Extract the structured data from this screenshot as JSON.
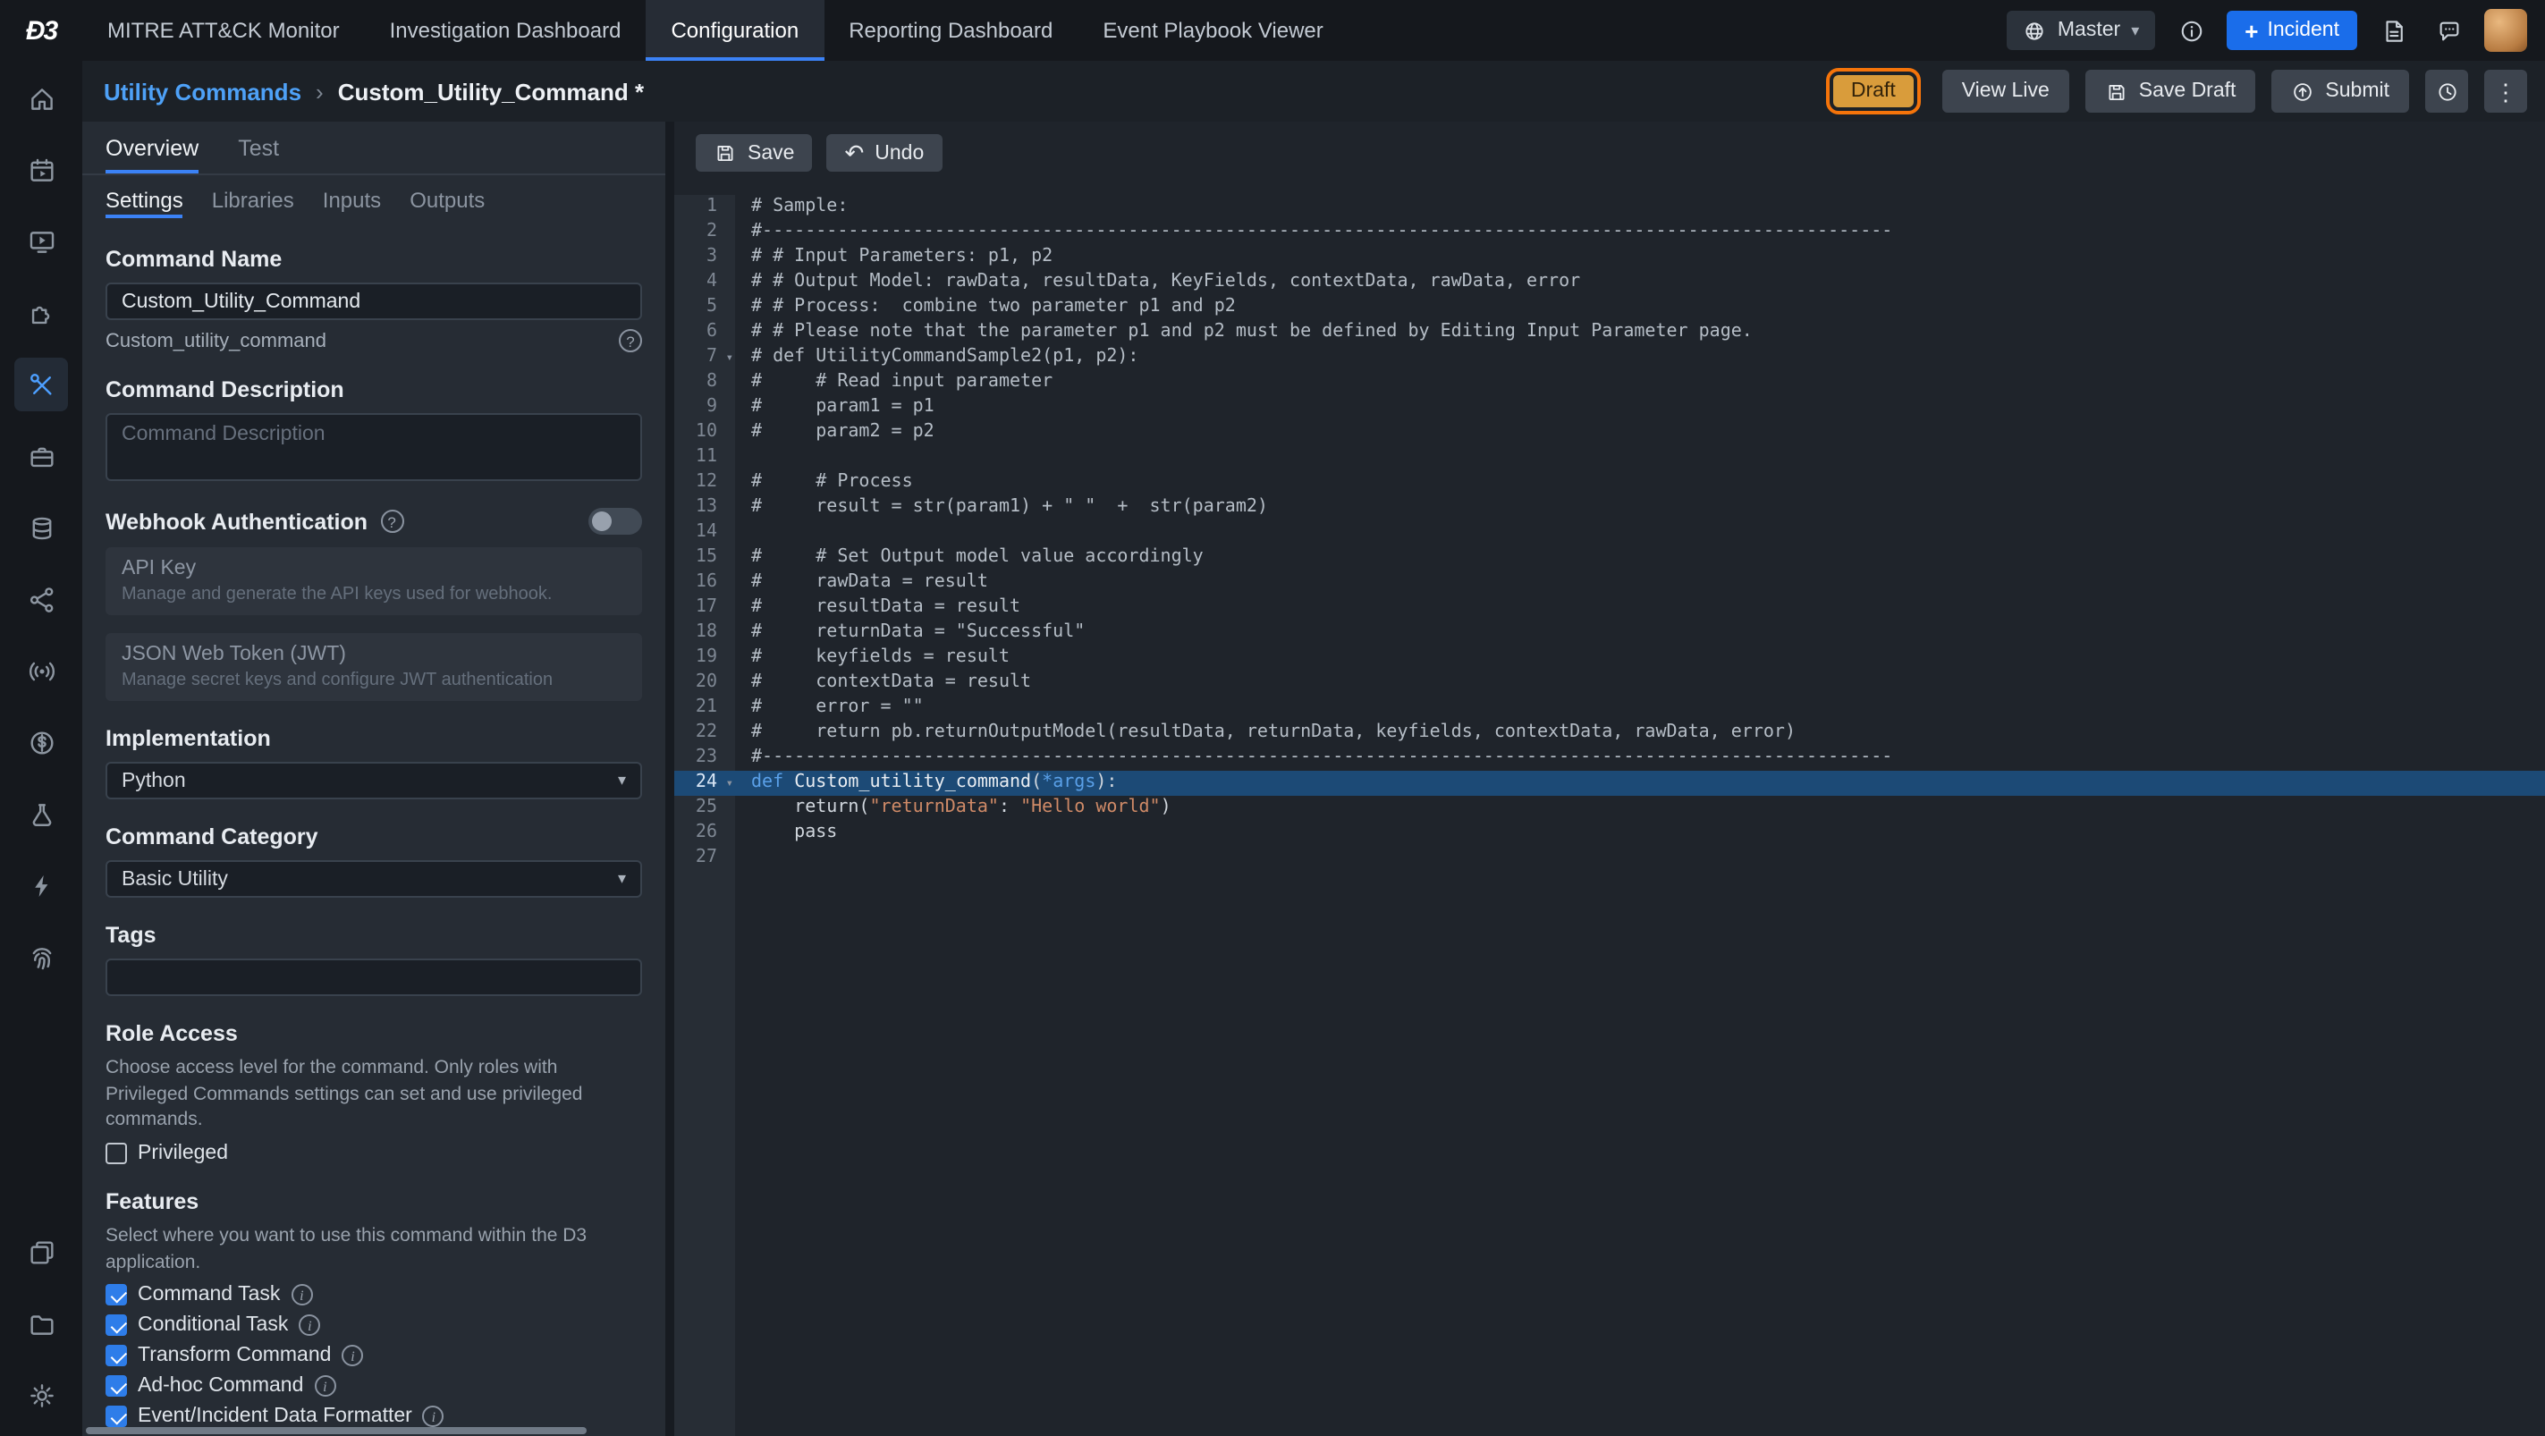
{
  "colors": {
    "accent_blue": "#3b82f6",
    "link_blue": "#4ea1f7",
    "incident_blue": "#1a6dea",
    "draft_badge_amber": "#d99c3b",
    "annotation_orange": "#f5740a",
    "active_line_blue": "#1c4a76",
    "editor_keyword": "#5aa0e8",
    "editor_string": "#cf8a67"
  },
  "topnav": {
    "logo": "Ð3",
    "items": [
      "MITRE ATT&CK Monitor",
      "Investigation Dashboard",
      "Configuration",
      "Reporting Dashboard",
      "Event Playbook Viewer"
    ],
    "active_index": 2,
    "master_label": "Master",
    "incident_label": "Incident"
  },
  "breadcrumb": {
    "parent": "Utility Commands",
    "separator": "›",
    "current": "Custom_Utility_Command *"
  },
  "header_actions": {
    "draft": "Draft",
    "view_live": "View Live",
    "save_draft": "Save Draft",
    "submit": "Submit"
  },
  "sidebar_rail": {
    "active_index": 4,
    "top": [
      "home-icon",
      "calendar-icon",
      "playbook-monitor-icon",
      "integrations-puzzle-icon",
      "utility-commands-tools-icon",
      "toolbox-icon",
      "data-stack-icon",
      "connections-share-icon",
      "live-signal-icon",
      "finance-globe-icon",
      "lab-flask-icon",
      "automation-bolt-icon",
      "fingerprint-icon"
    ],
    "bottom": [
      "window-copy-icon",
      "folders-icon",
      "settings-gear-icon"
    ]
  },
  "left_panel": {
    "tabs": [
      "Overview",
      "Test"
    ],
    "active_tab": 0,
    "subtabs": [
      "Settings",
      "Libraries",
      "Inputs",
      "Outputs"
    ],
    "active_subtab": 0,
    "command_name": {
      "label": "Command Name",
      "value": "Custom_Utility_Command",
      "internal_value": "Custom_utility_command"
    },
    "command_description": {
      "label": "Command Description",
      "placeholder": "Command Description",
      "value": ""
    },
    "webhook": {
      "label": "Webhook Authentication",
      "enabled": false,
      "api_key_title": "API Key",
      "api_key_desc": "Manage and generate the API keys used for webhook.",
      "jwt_title": "JSON Web Token (JWT)",
      "jwt_desc": "Manage secret keys and configure JWT authentication"
    },
    "implementation": {
      "label": "Implementation",
      "value": "Python"
    },
    "category": {
      "label": "Command Category",
      "value": "Basic Utility"
    },
    "tags": {
      "label": "Tags",
      "value": ""
    },
    "role_access": {
      "label": "Role Access",
      "desc": "Choose access level for the command. Only roles with Privileged Commands settings can set and use privileged commands.",
      "privileged_label": "Privileged",
      "privileged_checked": false
    },
    "features": {
      "label": "Features",
      "desc": "Select where you want to use this command within the D3 application.",
      "items": [
        {
          "label": "Command Task",
          "checked": true
        },
        {
          "label": "Conditional Task",
          "checked": true
        },
        {
          "label": "Transform Command",
          "checked": true
        },
        {
          "label": "Ad-hoc Command",
          "checked": true
        },
        {
          "label": "Event/Incident Data Formatter",
          "checked": true
        }
      ]
    }
  },
  "editor": {
    "toolbar": {
      "save": "Save",
      "undo": "Undo"
    },
    "active_line": 24,
    "lines": [
      {
        "n": 1,
        "segments": [
          {
            "t": "# Sample:",
            "c": "cm"
          }
        ]
      },
      {
        "n": 2,
        "segments": [
          {
            "t": "#---------------------------------------------------------------------------------------------------------",
            "c": "cm"
          }
        ]
      },
      {
        "n": 3,
        "segments": [
          {
            "t": "# # Input Parameters: p1, p2",
            "c": "cm"
          }
        ]
      },
      {
        "n": 4,
        "segments": [
          {
            "t": "# # Output Model: rawData, resultData, KeyFields, contextData, rawData, error",
            "c": "cm"
          }
        ]
      },
      {
        "n": 5,
        "segments": [
          {
            "t": "# # Process:  combine two parameter p1 and p2",
            "c": "cm"
          }
        ]
      },
      {
        "n": 6,
        "segments": [
          {
            "t": "# # Please note that the parameter p1 and p2 must be defined by Editing Input Parameter page.",
            "c": "cm"
          }
        ]
      },
      {
        "n": 7,
        "fold": true,
        "segments": [
          {
            "t": "# def UtilityCommandSample2(p1, p2):",
            "c": "cm"
          }
        ]
      },
      {
        "n": 8,
        "segments": [
          {
            "t": "#     # Read input parameter",
            "c": "cm"
          }
        ]
      },
      {
        "n": 9,
        "segments": [
          {
            "t": "#     param1 = p1",
            "c": "cm"
          }
        ]
      },
      {
        "n": 10,
        "segments": [
          {
            "t": "#     param2 = p2",
            "c": "cm"
          }
        ]
      },
      {
        "n": 11,
        "segments": []
      },
      {
        "n": 12,
        "segments": [
          {
            "t": "#     # Process",
            "c": "cm"
          }
        ]
      },
      {
        "n": 13,
        "segments": [
          {
            "t": "#     result = str(param1) + \" \"  +  str(param2)",
            "c": "cm"
          }
        ]
      },
      {
        "n": 14,
        "segments": []
      },
      {
        "n": 15,
        "segments": [
          {
            "t": "#     # Set Output model value accordingly",
            "c": "cm"
          }
        ]
      },
      {
        "n": 16,
        "segments": [
          {
            "t": "#     rawData = result",
            "c": "cm"
          }
        ]
      },
      {
        "n": 17,
        "segments": [
          {
            "t": "#     resultData = result",
            "c": "cm"
          }
        ]
      },
      {
        "n": 18,
        "segments": [
          {
            "t": "#     returnData = \"Successful\"",
            "c": "cm"
          }
        ]
      },
      {
        "n": 19,
        "segments": [
          {
            "t": "#     keyfields = result",
            "c": "cm"
          }
        ]
      },
      {
        "n": 20,
        "segments": [
          {
            "t": "#     contextData = result",
            "c": "cm"
          }
        ]
      },
      {
        "n": 21,
        "segments": [
          {
            "t": "#     error = \"\"",
            "c": "cm"
          }
        ]
      },
      {
        "n": 22,
        "segments": [
          {
            "t": "#     return pb.returnOutputModel(resultData, returnData, keyfields, contextData, rawData, error)",
            "c": "cm"
          }
        ]
      },
      {
        "n": 23,
        "segments": [
          {
            "t": "#---------------------------------------------------------------------------------------------------------",
            "c": "cm"
          }
        ]
      },
      {
        "n": 24,
        "fold": true,
        "segments": [
          {
            "t": "def ",
            "c": "kw"
          },
          {
            "t": "Custom_utility_command",
            "c": "fn"
          },
          {
            "t": "(",
            "c": "pl"
          },
          {
            "t": "*args",
            "c": "kw"
          },
          {
            "t": "):",
            "c": "pl"
          }
        ]
      },
      {
        "n": 25,
        "segments": [
          {
            "t": "    return(",
            "c": "pl"
          },
          {
            "t": "\"returnData\"",
            "c": "st"
          },
          {
            "t": ": ",
            "c": "pl"
          },
          {
            "t": "\"Hello world\"",
            "c": "st"
          },
          {
            "t": ")",
            "c": "pl"
          }
        ]
      },
      {
        "n": 26,
        "segments": [
          {
            "t": "    pass",
            "c": "pl"
          }
        ]
      },
      {
        "n": 27,
        "segments": []
      }
    ]
  }
}
